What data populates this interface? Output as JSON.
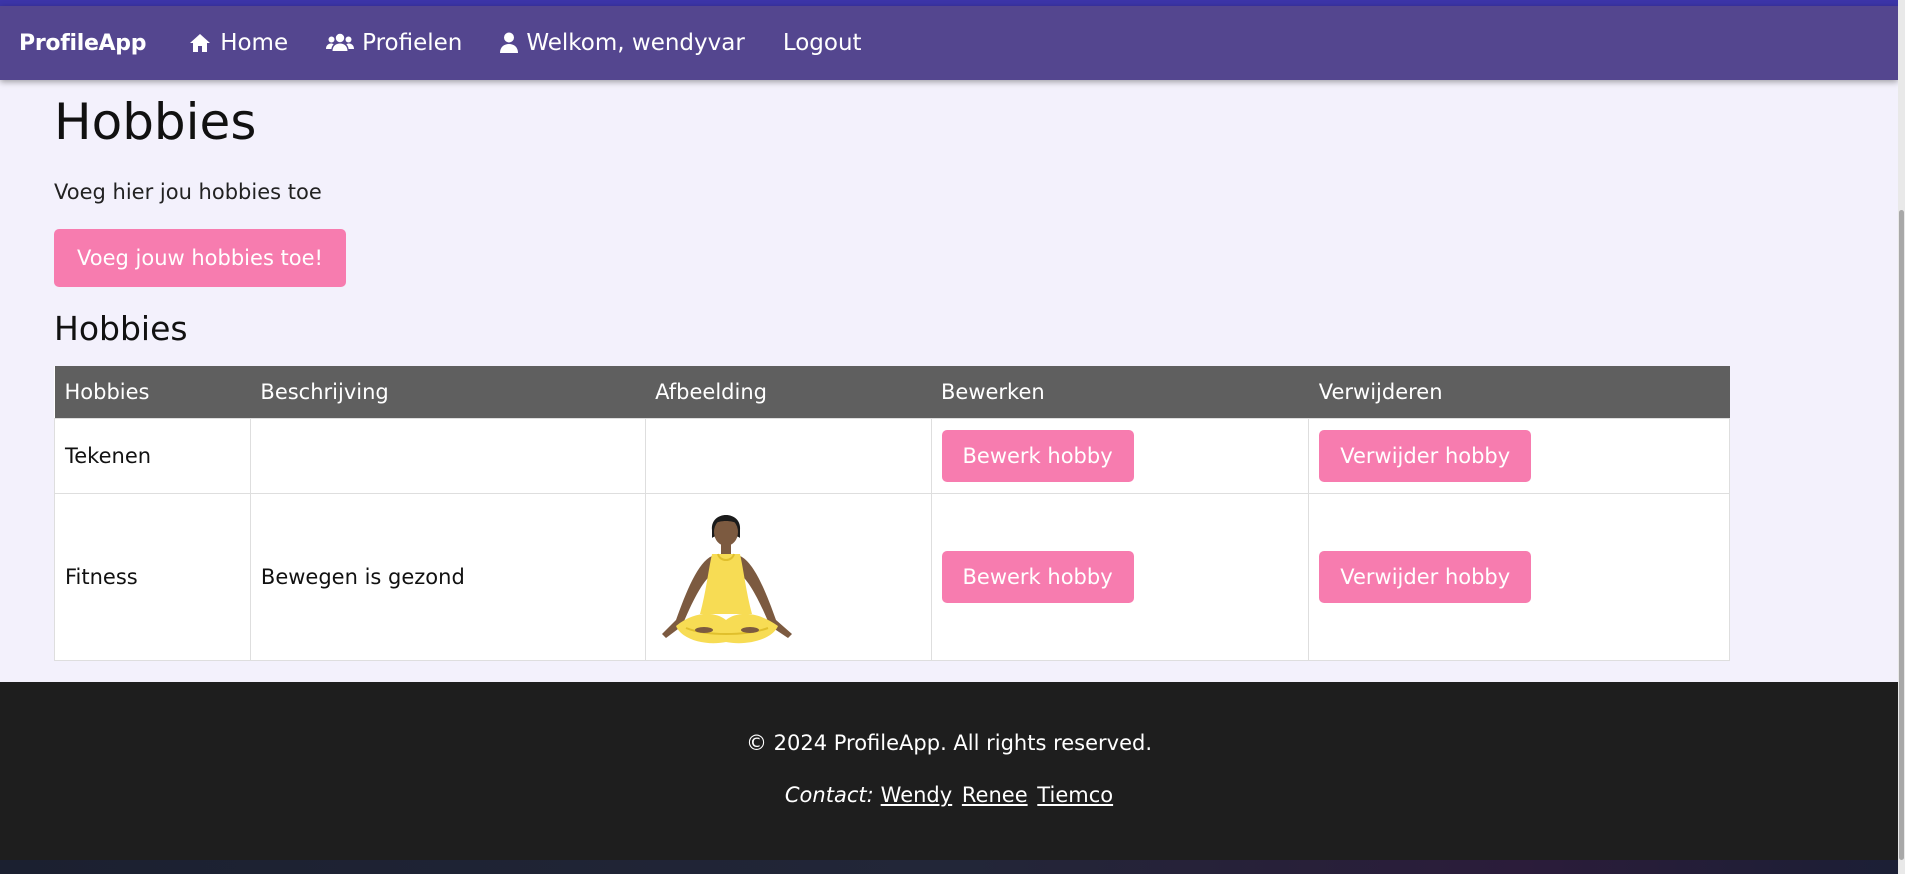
{
  "nav": {
    "brand": "ProfileApp",
    "home": "Home",
    "profiles": "Profielen",
    "welcome": "Welkom, wendyvar",
    "logout": "Logout"
  },
  "page": {
    "title": "Hobbies",
    "intro": "Voeg hier jou hobbies toe",
    "add_button": "Voeg jouw hobbies toe!",
    "section_title": "Hobbies"
  },
  "table": {
    "headers": [
      "Hobbies",
      "Beschrijving",
      "Afbeelding",
      "Bewerken",
      "Verwijderen"
    ],
    "rows": [
      {
        "hobby": "Tekenen",
        "description": "",
        "edit": "Bewerk hobby",
        "delete": "Verwijder hobby"
      },
      {
        "hobby": "Fitness",
        "description": "Bewegen is gezond",
        "edit": "Bewerk hobby",
        "delete": "Verwijder hobby"
      }
    ]
  },
  "footer": {
    "copyright": "© 2024 ProfileApp. All rights reserved.",
    "contact_label": "Contact:",
    "contacts": [
      "Wendy",
      "Renee",
      "Tiemco"
    ]
  },
  "colors": {
    "navbar": "#54468f",
    "accent_pink": "#f77caf",
    "table_header": "#5f5f5f",
    "footer": "#1e1e1e",
    "page_bg": "#f3f1fc"
  },
  "icons": {
    "home": "home-icon",
    "profiles": "users-icon",
    "welcome": "user-icon"
  }
}
